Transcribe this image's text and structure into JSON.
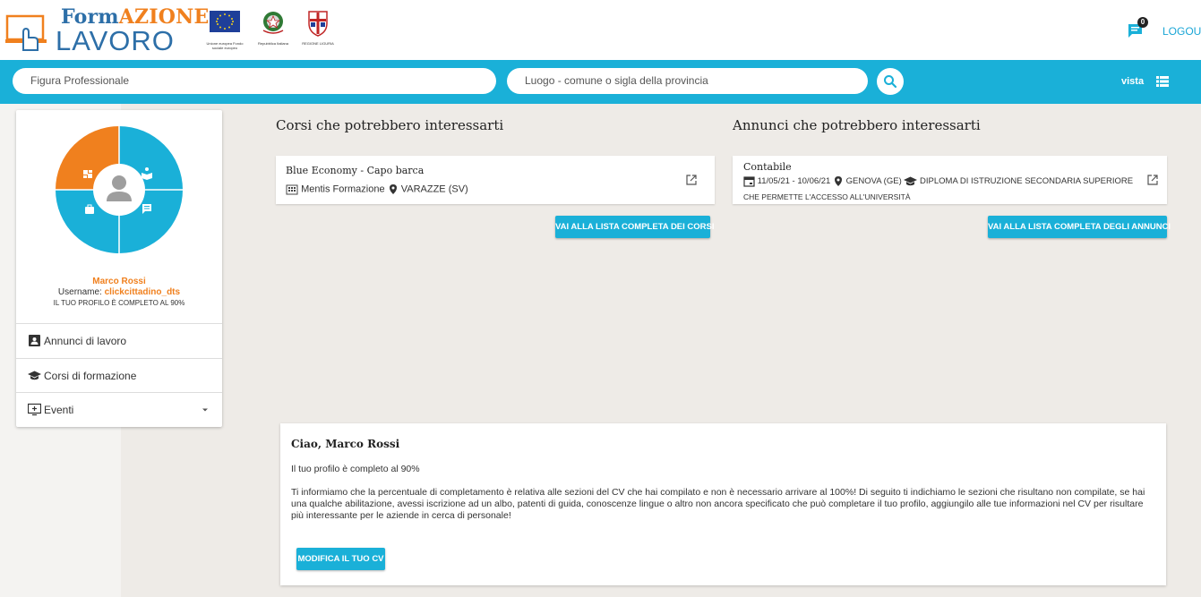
{
  "header": {
    "brand_top_a": "Form",
    "brand_top_b": "AZIONE",
    "brand_bottom": "LAVORO",
    "logo_eu_caption": "Unione europea Fondo sociale europeo",
    "logo_it_caption": "Repubblica Italiana",
    "logo_reg_caption": "REGIONE LIGURIA",
    "notification_count": "0",
    "logout_label": "LOGOUT"
  },
  "search": {
    "figura_placeholder": "Figura Professionale",
    "luogo_placeholder": "Luogo - comune o sigla della provincia",
    "vista_label": "vista"
  },
  "profile": {
    "name": "Marco Rossi",
    "username_label": "Username:",
    "username": "clickcittadino_dts",
    "completion_text": "IL TUO PROFILO È COMPLETO AL 90%",
    "menu": [
      {
        "label": "Annunci di lavoro"
      },
      {
        "label": "Corsi di formazione"
      },
      {
        "label": "Eventi"
      }
    ]
  },
  "courses": {
    "title": "Corsi che potrebbero interessarti",
    "item_title": "Blue Economy - Capo barca",
    "provider": "Mentis Formazione",
    "location": "VARAZZE (SV)",
    "button_label": "VAI ALLA LISTA COMPLETA DEI CORSI"
  },
  "ads": {
    "title": "Annunci che potrebbero interessarti",
    "item_title": "Contabile",
    "dates": "11/05/21 - 10/06/21",
    "location": "GENOVA (GE)",
    "education_line1": "DIPLOMA DI ISTRUZIONE SECONDARIA SUPERIORE",
    "education_line2": "CHE PERMETTE L'ACCESSO ALL'UNIVERSITÀ",
    "button_label": "VAI ALLA LISTA COMPLETA DEGLI ANNUNCI"
  },
  "welcome": {
    "title": "Ciao, Marco Rossi",
    "subtitle": "Il tuo profilo è completo al 90%",
    "body": "Ti informiamo che la percentuale di completamento è relativa alle sezioni del CV che hai compilato e non è necessario arrivare al 100%! Di seguito ti indichiamo le sezioni che risultano non compilate, se hai una qualche abilitazione, avessi iscrizione ad un albo, patenti di guida, conoscenze lingue o altro non ancora specificato che può completare il tuo profilo, aggiungilo alle tue informazioni nel CV per risultare più interessante per le aziende in cerca di personale!",
    "button_label": "MODIFICA IL TUO CV"
  },
  "colors": {
    "accent": "#1ab0d8",
    "orange": "#f0801e",
    "brand_blue": "#2d6fa8"
  }
}
